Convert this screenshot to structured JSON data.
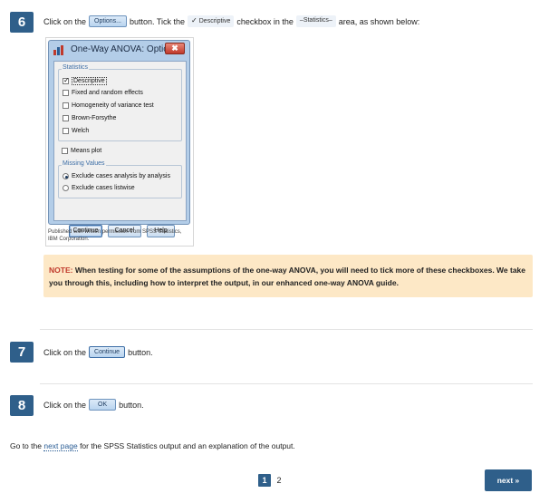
{
  "steps": {
    "six": {
      "number": "6",
      "before": "Click on the",
      "button": "Options...",
      "middle": "button. Tick the",
      "checkbox_chip": "Descriptive",
      "middle2": "checkbox in the",
      "area_chip": "–Statistics–",
      "after": "area, as shown below:"
    },
    "seven": {
      "number": "7",
      "before": "Click on the",
      "button": "Continue",
      "after": "button."
    },
    "eight": {
      "number": "8",
      "before": "Click on the",
      "button": "OK",
      "after": "button."
    }
  },
  "dialog": {
    "title": "One-Way ANOVA: Options",
    "close": "✖",
    "statistics": {
      "label": "Statistics",
      "options": [
        {
          "label": "Descriptive",
          "checked": true
        },
        {
          "label": "Fixed and random effects",
          "checked": false
        },
        {
          "label": "Homogeneity of variance test",
          "checked": false
        },
        {
          "label": "Brown-Forsythe",
          "checked": false
        },
        {
          "label": "Welch",
          "checked": false
        }
      ]
    },
    "means_plot": "Means plot",
    "missing": {
      "label": "Missing Values",
      "options": [
        {
          "label": "Exclude cases analysis by analysis",
          "checked": true
        },
        {
          "label": "Exclude cases listwise",
          "checked": false
        }
      ]
    },
    "buttons": {
      "continue": "Continue",
      "cancel": "Cancel",
      "help": "Help"
    }
  },
  "caption": "Published with written permission from SPSS Statistics, IBM Corporation.",
  "note": {
    "label": "NOTE:",
    "text": "When testing for some of the assumptions of the one-way ANOVA, you will need to tick more of these checkboxes. We take you through this, including how to interpret the output, in our enhanced one-way ANOVA guide."
  },
  "footer": {
    "before": "Go to the",
    "link": "next page",
    "after": "for the SPSS Statistics output and an explanation of the output."
  },
  "pagination": {
    "pages": [
      "1",
      "2"
    ],
    "current": "1",
    "next": "next »"
  },
  "colors": {
    "badge": "#2f5f8a",
    "note_bg": "#fde8c6",
    "note_label": "#c0392b",
    "link": "#2a5d95"
  }
}
